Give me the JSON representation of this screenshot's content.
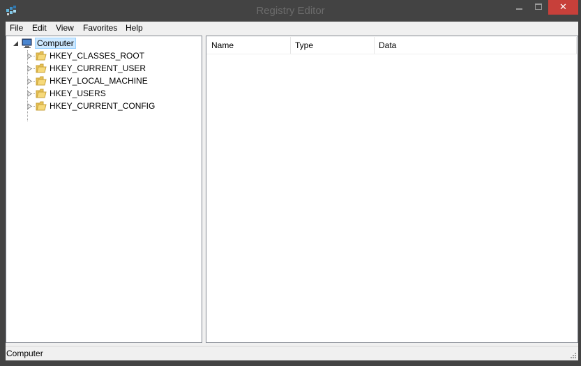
{
  "window": {
    "title": "Registry Editor",
    "close_glyph": "✕",
    "icons": {
      "app": "registry-editor-icon",
      "minimize": "minimize-icon",
      "maximize": "maximize-icon",
      "close": "close-icon"
    }
  },
  "menu": {
    "items": [
      "File",
      "Edit",
      "View",
      "Favorites",
      "Help"
    ]
  },
  "tree": {
    "root": {
      "label": "Computer",
      "icon": "computer-icon",
      "expanded": true,
      "selected": true
    },
    "children": [
      {
        "label": "HKEY_CLASSES_ROOT",
        "icon": "folder-icon"
      },
      {
        "label": "HKEY_CURRENT_USER",
        "icon": "folder-icon"
      },
      {
        "label": "HKEY_LOCAL_MACHINE",
        "icon": "folder-icon"
      },
      {
        "label": "HKEY_USERS",
        "icon": "folder-icon"
      },
      {
        "label": "HKEY_CURRENT_CONFIG",
        "icon": "folder-icon"
      }
    ]
  },
  "list": {
    "columns": [
      "Name",
      "Type",
      "Data"
    ],
    "rows": []
  },
  "status": {
    "path": "Computer"
  },
  "colors": {
    "titlebar": "#434343",
    "close_button": "#c7403a",
    "selection": "#cce8ff",
    "folder": "#e8c256"
  }
}
